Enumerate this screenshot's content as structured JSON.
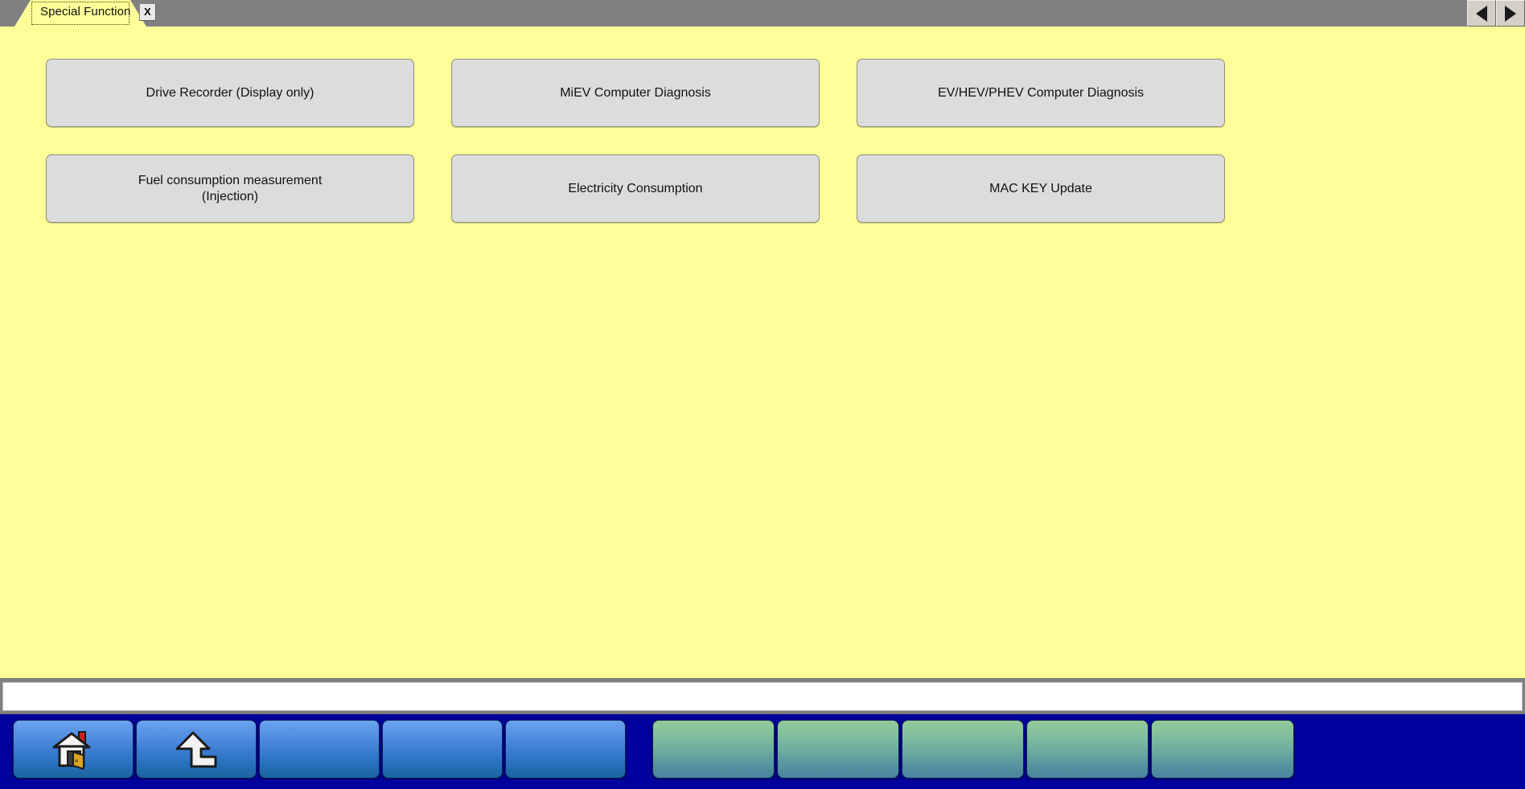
{
  "window": {
    "background_color": "#ffff99",
    "chrome_color": "#808080"
  },
  "tabstrip": {
    "tabs": [
      {
        "label": "Special Function",
        "close_label": "X",
        "active": true
      }
    ],
    "nav": {
      "prev_icon": "triangle-left-icon",
      "next_icon": "triangle-right-icon"
    }
  },
  "main": {
    "buttons": [
      {
        "label": "Drive Recorder (Display only)"
      },
      {
        "label": "MiEV Computer Diagnosis"
      },
      {
        "label": "EV/HEV/PHEV Computer Diagnosis"
      },
      {
        "label": "Fuel consumption measurement\n(Injection)"
      },
      {
        "label": "Electricity Consumption"
      },
      {
        "label": "MAC KEY Update"
      }
    ]
  },
  "status_bar": {
    "message": ""
  },
  "toolbar": {
    "background_color": "#00009c",
    "blue_buttons": [
      {
        "icon": "home-icon",
        "label": ""
      },
      {
        "icon": "up-arrow-icon",
        "label": ""
      },
      {
        "icon": "",
        "label": ""
      },
      {
        "icon": "",
        "label": ""
      },
      {
        "icon": "",
        "label": ""
      }
    ],
    "green_buttons": [
      {
        "icon": "",
        "label": ""
      },
      {
        "icon": "",
        "label": ""
      },
      {
        "icon": "",
        "label": ""
      },
      {
        "icon": "",
        "label": ""
      },
      {
        "icon": "",
        "label": ""
      }
    ]
  }
}
